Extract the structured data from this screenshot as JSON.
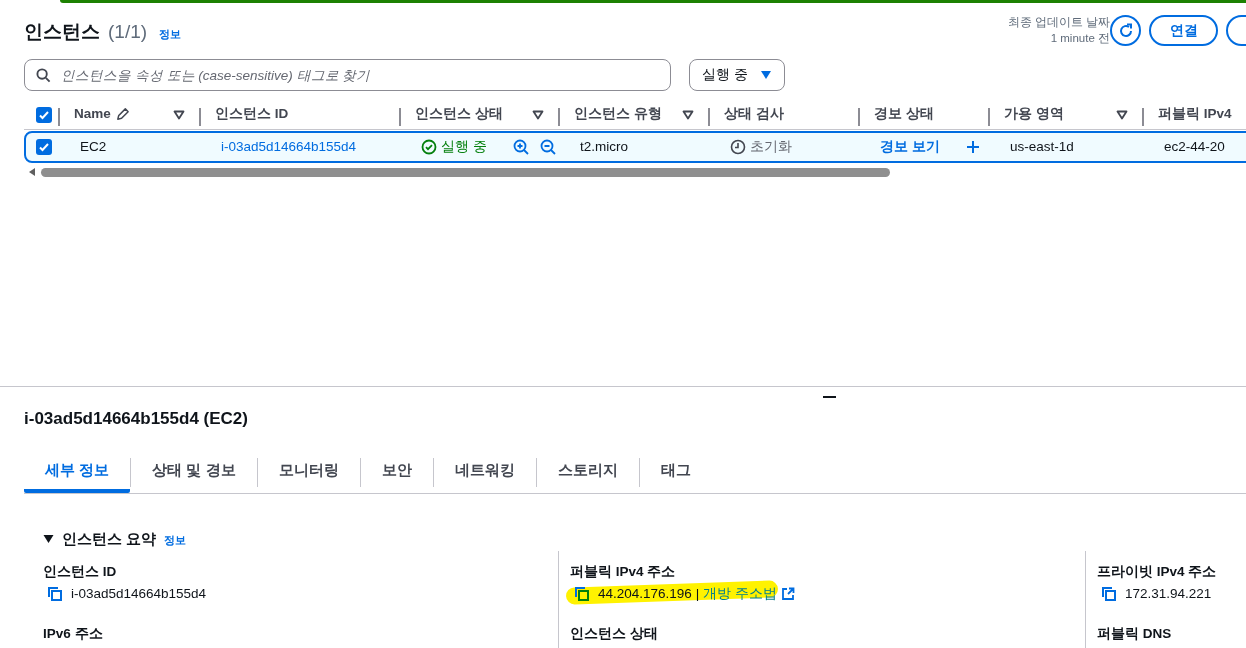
{
  "header": {
    "title": "인스턴스",
    "count": "(1/1)",
    "info": "정보",
    "updated_label": "최종 업데이트 날짜",
    "updated_value": "1 minute 전",
    "connect": "연결"
  },
  "search": {
    "placeholder": "인스턴스을 속성 또는 (case-sensitive) 태그로 찾기"
  },
  "state_filter": "실행 중",
  "table": {
    "all_checked": true,
    "columns": [
      {
        "label": "Name",
        "kind": "editable"
      },
      {
        "label": "인스턴스 ID",
        "kind": "plain"
      },
      {
        "label": "인스턴스 상태",
        "kind": "filterable"
      },
      {
        "label": "인스턴스 유형",
        "kind": "filterable"
      },
      {
        "label": "상태 검사",
        "kind": "plain"
      },
      {
        "label": "경보 상태",
        "kind": "plain"
      },
      {
        "label": "가용 영역",
        "kind": "filterable"
      },
      {
        "label": "퍼블릭 IPv4",
        "kind": "plain"
      }
    ],
    "rows": [
      {
        "selected": true,
        "checked": true,
        "name": "EC2",
        "id": "i-03ad5d14664b155d4",
        "state": "실행 중",
        "type": "t2.micro",
        "status_check": "초기화",
        "alarm": "경보 보기",
        "zone": "us-east-1d",
        "public_dns": "ec2-44-20"
      }
    ]
  },
  "details": {
    "title": "i-03ad5d14664b155d4 (EC2)",
    "tabs": [
      {
        "label": "세부 정보",
        "selected": true
      },
      {
        "label": "상태 및 경보",
        "selected": false
      },
      {
        "label": "모니터링",
        "selected": false
      },
      {
        "label": "보안",
        "selected": false
      },
      {
        "label": "네트워킹",
        "selected": false
      },
      {
        "label": "스토리지",
        "selected": false
      },
      {
        "label": "태그",
        "selected": false
      }
    ],
    "section": {
      "title": "인스턴스 요약",
      "info": "정보",
      "expanded": true,
      "columns": [
        [
          {
            "label": "인스턴스 ID",
            "value": "i-03ad5d14664b155d4",
            "highlighted": false
          },
          {
            "label": "IPv6 주소"
          }
        ],
        [
          {
            "label": "퍼블릭 IPv4 주소",
            "value": "44.204.176.196",
            "separator": "|",
            "link": "개방 주소법",
            "highlighted": true
          },
          {
            "label": "인스턴스 상태"
          }
        ],
        [
          {
            "label": "프라이빗 IPv4 주소",
            "value": "172.31.94.221",
            "highlighted": false
          },
          {
            "label": "퍼블릭 DNS"
          }
        ]
      ]
    }
  }
}
